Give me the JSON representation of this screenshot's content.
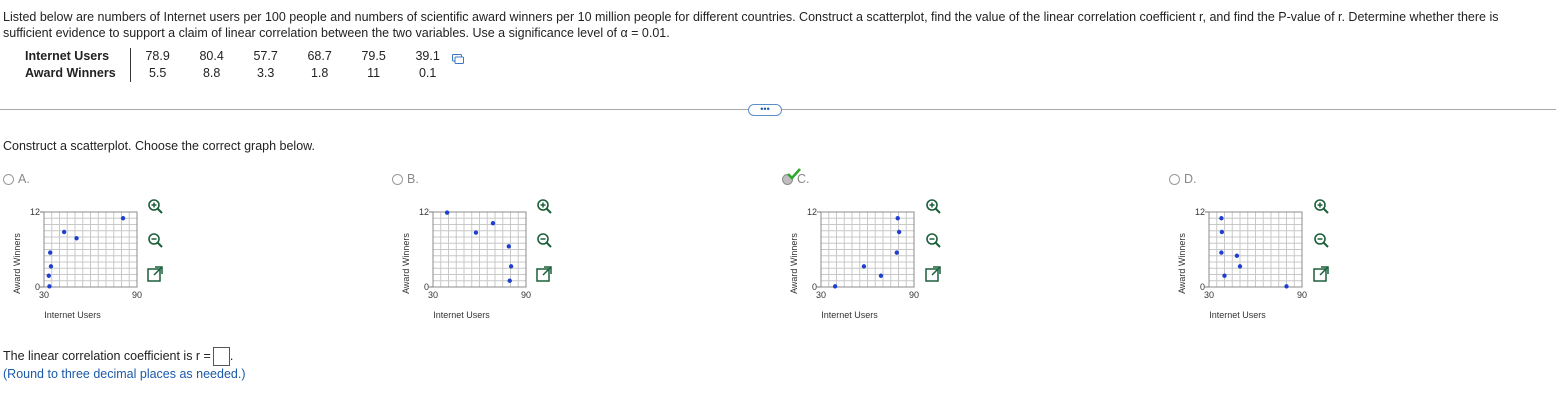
{
  "question": {
    "intro": "Listed below are numbers of Internet users per 100 people and numbers of scientific award winners per 10 million people for different countries. Construct a scatterplot, find the value of the linear correlation coefficient r, and find the P-value of r. Determine whether there is sufficient evidence to support a claim of linear correlation between the two variables. Use a significance level of α = 0.01."
  },
  "table": {
    "row1_label": "Internet Users",
    "row2_label": "Award Winners",
    "internet_users": [
      "78.9",
      "80.4",
      "57.7",
      "68.7",
      "79.5",
      "39.1"
    ],
    "award_winners": [
      "5.5",
      "8.8",
      "3.3",
      "1.8",
      "11",
      "0.1"
    ]
  },
  "more_button": "•••",
  "step": {
    "prompt": "Construct a scatterplot. Choose the correct graph below."
  },
  "options": [
    {
      "letter": "A.",
      "selected": false,
      "correct": false
    },
    {
      "letter": "B.",
      "selected": false,
      "correct": false
    },
    {
      "letter": "C.",
      "selected": true,
      "correct": true
    },
    {
      "letter": "D.",
      "selected": false,
      "correct": false
    }
  ],
  "graph_axes": {
    "xlabel": "Internet Users",
    "ylabel": "Award Winners",
    "xmin_label": "30",
    "xmax_label": "90",
    "ymin_label": "0",
    "ymax_label": "12",
    "xlim": [
      30,
      90
    ],
    "ylim": [
      0,
      12
    ]
  },
  "chart_data": [
    {
      "type": "scatter",
      "option": "A",
      "points": [
        [
          33.5,
          0.1
        ],
        [
          33.1,
          1.8
        ],
        [
          34.5,
          3.3
        ],
        [
          34.0,
          5.5
        ],
        [
          43.0,
          8.8
        ],
        [
          51.0,
          7.8
        ],
        [
          81.0,
          11.0
        ]
      ],
      "xlim": [
        30,
        90
      ],
      "ylim": [
        0,
        12
      ],
      "xlabel": "Internet Users",
      "ylabel": "Award Winners"
    },
    {
      "type": "scatter",
      "option": "B",
      "points": [
        [
          39.1,
          11.9
        ],
        [
          57.7,
          8.7
        ],
        [
          68.7,
          10.2
        ],
        [
          78.9,
          6.5
        ],
        [
          79.5,
          1.0
        ],
        [
          80.4,
          3.3
        ]
      ],
      "xlim": [
        30,
        90
      ],
      "ylim": [
        0,
        12
      ],
      "xlabel": "Internet Users",
      "ylabel": "Award Winners"
    },
    {
      "type": "scatter",
      "option": "C",
      "points": [
        [
          39.1,
          0.1
        ],
        [
          57.7,
          3.3
        ],
        [
          68.7,
          1.8
        ],
        [
          78.9,
          5.5
        ],
        [
          79.5,
          11.0
        ],
        [
          80.4,
          8.8
        ]
      ],
      "xlim": [
        30,
        90
      ],
      "ylim": [
        0,
        12
      ],
      "xlabel": "Internet Users",
      "ylabel": "Award Winners"
    },
    {
      "type": "scatter",
      "option": "D",
      "points": [
        [
          38.0,
          11.0
        ],
        [
          38.3,
          8.8
        ],
        [
          38.0,
          5.5
        ],
        [
          48.0,
          5.0
        ],
        [
          50.0,
          3.3
        ],
        [
          40.0,
          1.8
        ],
        [
          80.0,
          0.1
        ]
      ],
      "xlim": [
        30,
        90
      ],
      "ylim": [
        0,
        12
      ],
      "xlabel": "Internet Users",
      "ylabel": "Award Winners"
    }
  ],
  "r_line": {
    "prefix": "The linear correlation coefficient is r =",
    "suffix": ".",
    "value": ""
  },
  "round_note": "(Round to three decimal places as needed.)",
  "colors": {
    "point": "#1f3fd1",
    "grid": "#c8c8c8",
    "link": "#1a5aa8",
    "check": "#2fa82f"
  }
}
